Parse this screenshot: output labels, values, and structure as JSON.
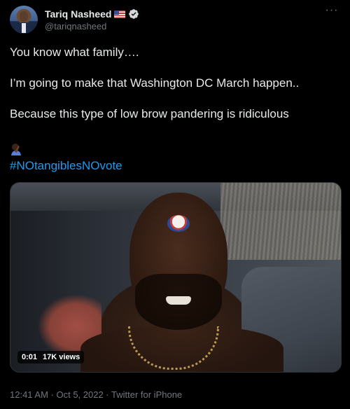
{
  "user": {
    "display_name": "Tariq Nasheed",
    "handle": "@tariqnasheed",
    "flag_icon": "us-flag-icon",
    "verified_icon": "verified-badge-icon"
  },
  "tweet": {
    "lines": [
      "You know what family….",
      "I’m going to make that Washington DC March happen..",
      "Because this type of low brow pandering is ridiculous"
    ],
    "emoji_icon": "person-facepalming-icon",
    "hashtag": "#NOtangiblesNOvote"
  },
  "media": {
    "duration": "0:01",
    "views": "17K views"
  },
  "footer": {
    "meta": "12:41 AM · Oct 5, 2022 · Twitter for iPhone"
  },
  "colors": {
    "background": "#000000",
    "text": "#e7e9ea",
    "secondary": "#71767b",
    "accent": "#1d9bf0"
  }
}
